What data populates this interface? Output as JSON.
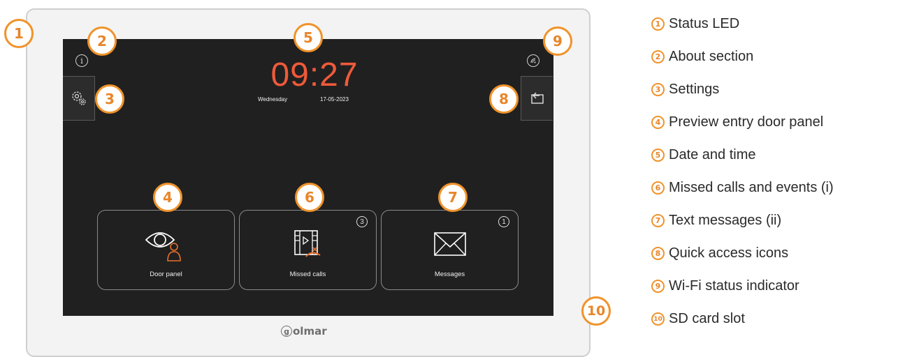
{
  "device": {
    "brand": "olmar",
    "brand_initial": "g",
    "screen": {
      "time": "09:27",
      "weekday": "Wednesday",
      "date": "17-05-2023",
      "tiles": [
        {
          "label": "Door panel",
          "badge": ""
        },
        {
          "label": "Missed calls",
          "badge": "3"
        },
        {
          "label": "Messages",
          "badge": "1"
        }
      ],
      "info_icon": "i"
    }
  },
  "callouts": [
    "1",
    "2",
    "3",
    "4",
    "5",
    "6",
    "7",
    "8",
    "9",
    "10"
  ],
  "legend": [
    {
      "num": "1",
      "label": "Status LED"
    },
    {
      "num": "2",
      "label": "About section"
    },
    {
      "num": "3",
      "label": "Settings"
    },
    {
      "num": "4",
      "label": "Preview entry door panel"
    },
    {
      "num": "5",
      "label": "Date and time"
    },
    {
      "num": "6",
      "label": "Missed calls and events (i)"
    },
    {
      "num": "7",
      "label": "Text messages (ii)"
    },
    {
      "num": "8",
      "label": "Quick access icons"
    },
    {
      "num": "9",
      "label": "Wi-Fi status indicator"
    },
    {
      "num": "10",
      "label": "SD card slot"
    }
  ],
  "colors": {
    "accent": "#f0932b",
    "clock": "#ef5a3a",
    "screen": "#202020",
    "icon_orange": "#e8702a"
  }
}
